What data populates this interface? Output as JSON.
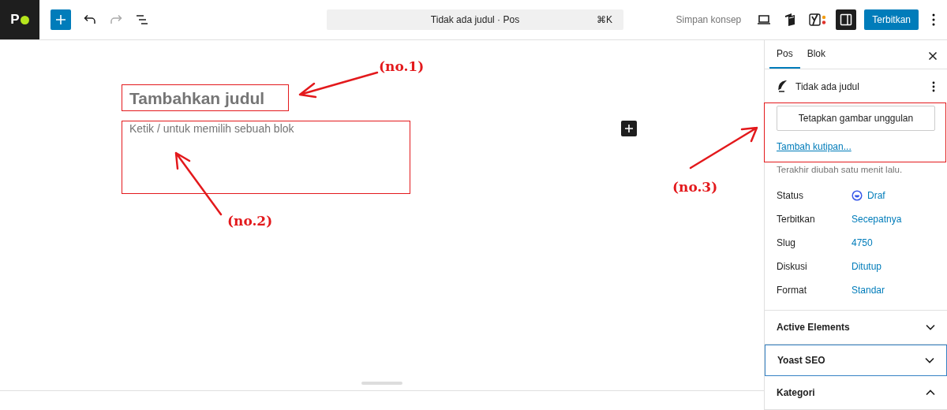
{
  "logo": {
    "letter": "P"
  },
  "toolbar": {
    "undo_disabled": false,
    "redo_disabled": true
  },
  "command_bar": {
    "title": "Tidak ada judul · Pos",
    "shortcut": "⌘K"
  },
  "save_draft": "Simpan konsep",
  "sidebar_toggle": {
    "on": true
  },
  "publish_button": "Terbitkan",
  "editor": {
    "title_placeholder": "Tambahkan judul",
    "body_placeholder": "Ketik / untuk memilih sebuah blok"
  },
  "annotations": [
    {
      "label": "(no.1)"
    },
    {
      "label": "(no.2)"
    },
    {
      "label": "(no.3)"
    }
  ],
  "sidebar": {
    "tabs": [
      {
        "label": "Pos",
        "selected": true
      },
      {
        "label": "Blok",
        "selected": false
      }
    ],
    "post_title": "Tidak ada judul",
    "featured_image_button": "Tetapkan gambar unggulan",
    "excerpt_link": "Tambah kutipan...",
    "last_modified": "Terakhir diubah satu menit lalu.",
    "fields": [
      {
        "label": "Status",
        "value": "Draf",
        "kind": "status"
      },
      {
        "label": "Terbitkan",
        "value": "Secepatnya",
        "kind": "link"
      },
      {
        "label": "Slug",
        "value": "4750",
        "kind": "link"
      },
      {
        "label": "Diskusi",
        "value": "Ditutup",
        "kind": "link"
      },
      {
        "label": "Format",
        "value": "Standar",
        "kind": "link"
      }
    ],
    "panels": [
      {
        "title": "Active Elements",
        "expanded": false,
        "focused": false
      },
      {
        "title": "Yoast SEO",
        "expanded": false,
        "focused": true
      },
      {
        "title": "Kategori",
        "expanded": true,
        "focused": false
      }
    ]
  }
}
